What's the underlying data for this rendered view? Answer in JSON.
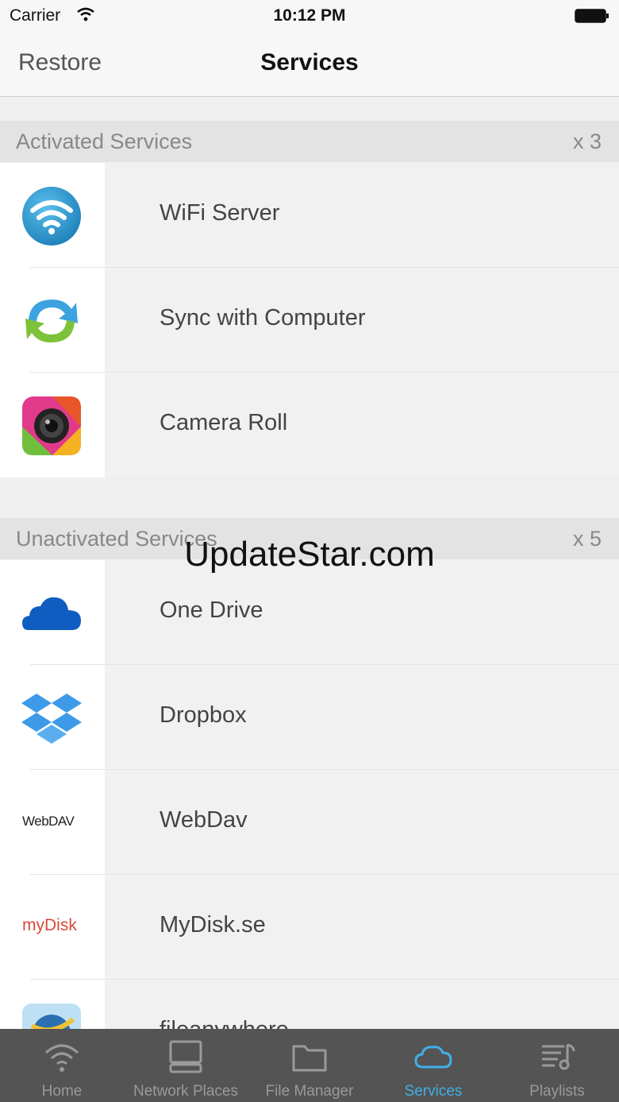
{
  "status_bar": {
    "carrier": "Carrier",
    "time": "10:12 PM"
  },
  "nav": {
    "back_label": "Restore",
    "title": "Services"
  },
  "activated": {
    "header": "Activated Services",
    "count": "x 3",
    "items": [
      {
        "name": "WiFi Server",
        "icon": "wifi-server-icon"
      },
      {
        "name": "Sync with Computer",
        "icon": "sync-icon"
      },
      {
        "name": "Camera Roll",
        "icon": "camera-roll-icon"
      }
    ]
  },
  "unactivated": {
    "header": "Unactivated Services",
    "count": "x 5",
    "items": [
      {
        "name": "One Drive",
        "icon": "onedrive-icon"
      },
      {
        "name": "Dropbox",
        "icon": "dropbox-icon"
      },
      {
        "name": "WebDav",
        "icon": "webdav-icon",
        "logo_text": "WebDAV"
      },
      {
        "name": "MyDisk.se",
        "icon": "mydisk-icon",
        "logo_text": "myDisk"
      },
      {
        "name": "fileanywhere",
        "icon": "fileanywhere-icon"
      }
    ]
  },
  "watermark": "UpdateStar.com",
  "tabs": [
    {
      "label": "Home",
      "icon": "home-wifi-icon"
    },
    {
      "label": "Network Places",
      "icon": "network-places-icon"
    },
    {
      "label": "File Manager",
      "icon": "folder-icon"
    },
    {
      "label": "Services",
      "icon": "cloud-icon",
      "active": true
    },
    {
      "label": "Playlists",
      "icon": "playlist-icon"
    }
  ],
  "colors": {
    "accent": "#3fb0e8",
    "tabbar": "#545454",
    "section": "#e3e3e3"
  }
}
